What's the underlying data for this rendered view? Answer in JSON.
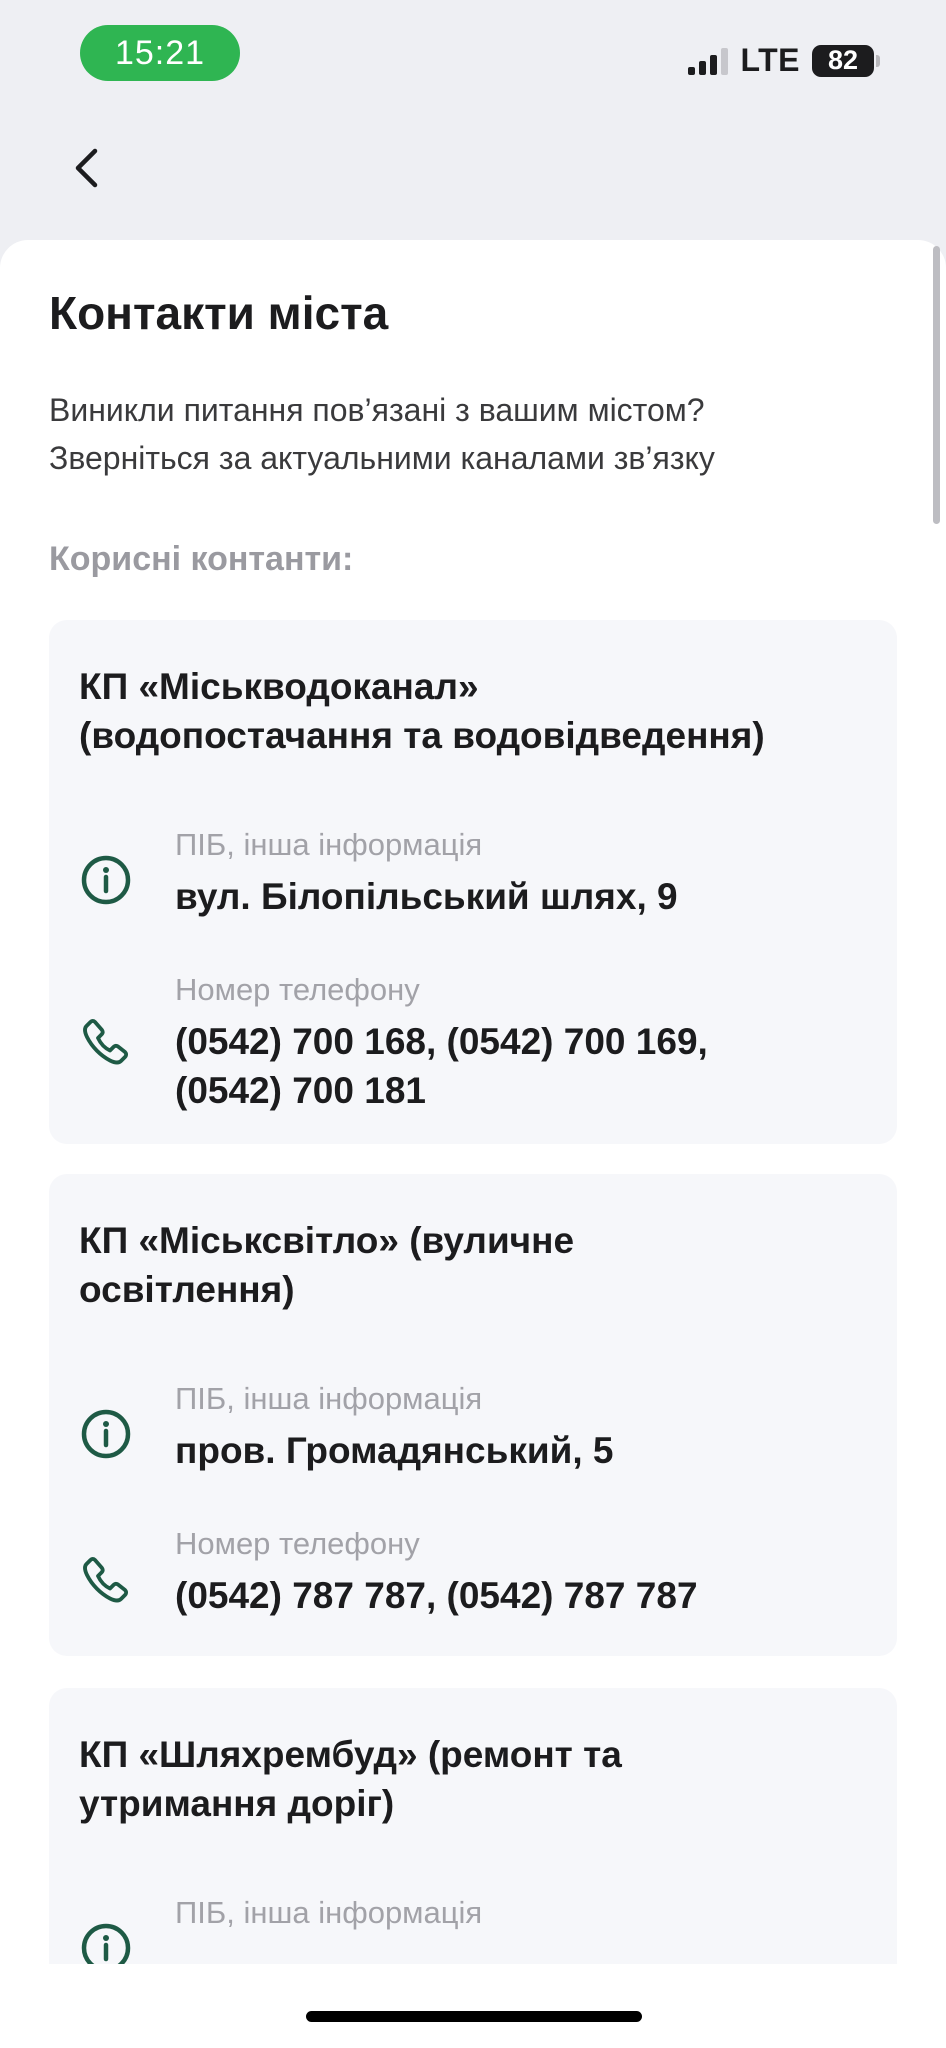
{
  "status_bar": {
    "time": "15:21",
    "network": "LTE",
    "battery": "82"
  },
  "page": {
    "title": "Контакти міста",
    "intro_line1": "Виникли питання пов’язані з вашим містом?",
    "intro_line2": "Зверніться за актуальними каналами зв’язку",
    "section_label": "Корисні контанти:"
  },
  "contacts": [
    {
      "title_line1": "КП «Міськводоканал»",
      "title_line2": "(водопостачання та водовідведення)",
      "info_label": "ПІБ, інша інформація",
      "info_value": "вул. Білопільський шлях, 9",
      "phone_label": "Номер телефону",
      "phone_line1": "(0542) 700 168, (0542) 700 169,",
      "phone_line2": "(0542) 700 181"
    },
    {
      "title_line1": "КП «Міськсвітло» (вуличне",
      "title_line2": "освітлення)",
      "info_label": "ПІБ, інша інформація",
      "info_value": "пров. Громадянський, 5",
      "phone_label": "Номер телефону",
      "phone_line1": "(0542) 787 787, (0542) 787 787"
    },
    {
      "title_line1": "КП «Шляхрембуд» (ремонт та",
      "title_line2": "утримання доріг)",
      "info_label": "ПІБ, інша інформація"
    }
  ],
  "colors": {
    "accent": "#1e5a45",
    "status_pill": "#2fb552",
    "card_bg": "#f6f7fa"
  }
}
